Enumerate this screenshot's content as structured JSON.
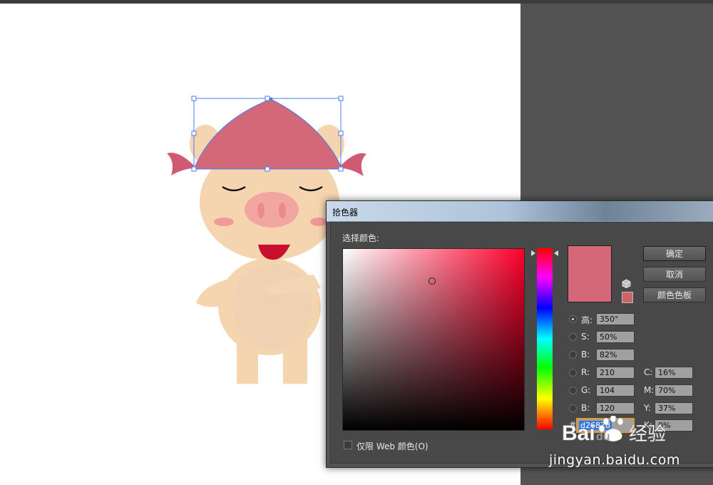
{
  "dialog": {
    "title": "拾色器",
    "select_label": "选择颜色:",
    "buttons": {
      "ok": "确定",
      "cancel": "取消",
      "swatches": "颜色色板"
    },
    "hsb": [
      {
        "label": "高:",
        "value": "350°",
        "checked": true
      },
      {
        "label": "S:",
        "value": "50%",
        "checked": false
      },
      {
        "label": "B:",
        "value": "82%",
        "checked": false
      }
    ],
    "rgb": [
      {
        "label": "R:",
        "value": "210"
      },
      {
        "label": "G:",
        "value": "104"
      },
      {
        "label": "B:",
        "value": "120"
      }
    ],
    "cmyk": [
      {
        "label": "C:",
        "value": "16%"
      },
      {
        "label": "M:",
        "value": "70%"
      },
      {
        "label": "Y:",
        "value": "37%"
      },
      {
        "label": "K:",
        "value": "0%"
      }
    ],
    "hex": {
      "hash": "#",
      "value": "d26878"
    },
    "web_only_label": "仅限 Web 颜色(O)",
    "current_color": "#d26878",
    "web_safe_color": "#cc6666"
  },
  "colors": {
    "pig_skin": "#f5d5b0",
    "pig_belly": "#f0d2b2",
    "snout": "#f2a6a1",
    "nostril": "#e98b8c",
    "cheek": "#ef9a9a",
    "mouth": "#c8102e",
    "scarf": "#d26878",
    "selection": "#4a7cf0"
  },
  "watermark": {
    "text": "Bai du 经验",
    "url": "jingyan.baidu.com"
  }
}
